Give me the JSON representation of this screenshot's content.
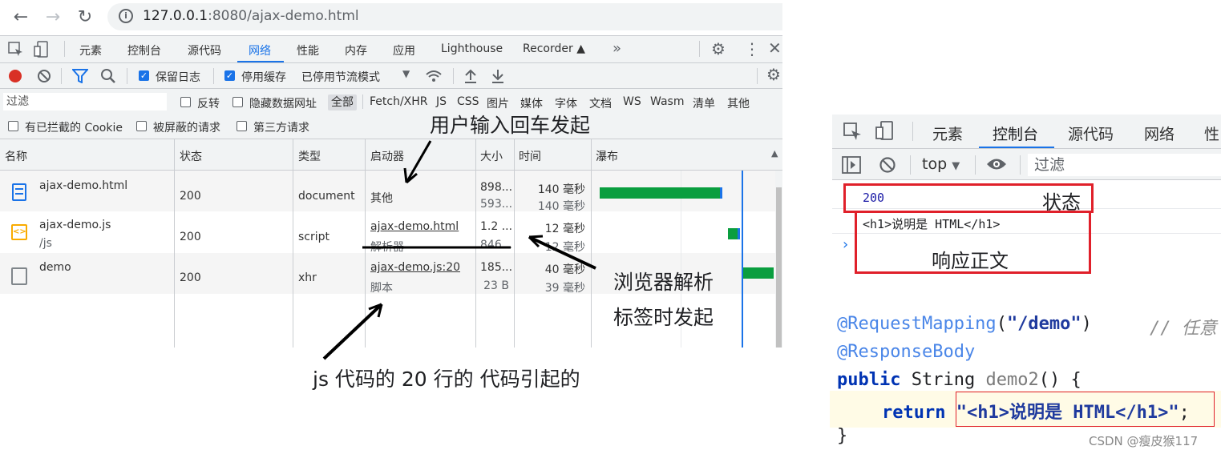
{
  "browser": {
    "url_host": "127.0.0.1",
    "url_rest": ":8080/ajax-demo.html"
  },
  "devtools": {
    "tabs": [
      "元素",
      "控制台",
      "源代码",
      "网络",
      "性能",
      "内存",
      "应用",
      "Lighthouse",
      "Recorder"
    ],
    "active_tab": "网络",
    "toolbar": {
      "preserve_log": "保留日志",
      "disable_cache": "停用缓存",
      "throttling": "已停用节流模式"
    },
    "filter": {
      "placeholder": "过滤",
      "invert": "反转",
      "hide_data_urls": "隐藏数据网址",
      "types": [
        "全部",
        "Fetch/XHR",
        "JS",
        "CSS",
        "图片",
        "媒体",
        "字体",
        "文档",
        "WS",
        "Wasm",
        "清单",
        "其他"
      ]
    },
    "filter2": {
      "blocked_cookies": "有已拦截的 Cookie",
      "blocked_requests": "被屏蔽的请求",
      "third_party": "第三方请求"
    },
    "columns": [
      "名称",
      "状态",
      "类型",
      "启动器",
      "大小",
      "时间",
      "瀑布"
    ],
    "rows": [
      {
        "name": "ajax-demo.html",
        "path": "",
        "status": "200",
        "type": "document",
        "initiator": "其他",
        "initiator_sub": "",
        "size1": "898...",
        "size2": "593...",
        "time1": "140 毫秒",
        "time2": "140 毫秒"
      },
      {
        "name": "ajax-demo.js",
        "path": "/js",
        "status": "200",
        "type": "script",
        "initiator": "ajax-demo.html",
        "initiator_sub": "解析器",
        "size1": "1.2 ...",
        "size2": "846...",
        "time1": "12 毫秒",
        "time2": "12 毫秒"
      },
      {
        "name": "demo",
        "path": "",
        "status": "200",
        "type": "xhr",
        "initiator": "ajax-demo.js:20",
        "initiator_sub": "脚本",
        "size1": "185...",
        "size2": "23 B",
        "time1": "40 毫秒",
        "time2": "39 毫秒"
      }
    ]
  },
  "annotations": {
    "user_enter": "用户输入回车发起",
    "browser_parse_1": "浏览器解析",
    "browser_parse_2": "标签时发起",
    "js_line": "js 代码的 20 行的 代码引起的"
  },
  "console": {
    "tabs": [
      "元素",
      "控制台",
      "源代码",
      "网络",
      "性"
    ],
    "active_tab": "控制台",
    "context": "top",
    "filter_placeholder": "过滤",
    "status_value": "200",
    "status_label": "状态",
    "body_value": "<h1>说明是 HTML</h1>",
    "body_label": "响应正文"
  },
  "code": {
    "line1_anno": "@RequestMapping",
    "line1_arg": "\"/demo\"",
    "line1_comment": "// 任意",
    "line2_anno": "@ResponseBody",
    "line3_kw": "public",
    "line3_type": "String",
    "line3_method": "demo2",
    "line3_rest": "() {",
    "line4_kw": "return",
    "line4_str": "\"<h1>说明是 HTML</h1>\"",
    "line4_end": ";",
    "line5": "}"
  },
  "watermark": "CSDN @瘦皮猴117",
  "colors": {
    "accent": "#1a73e8",
    "annotation_red": "#e0202a",
    "waterfall_green": "#0a9e3f"
  }
}
